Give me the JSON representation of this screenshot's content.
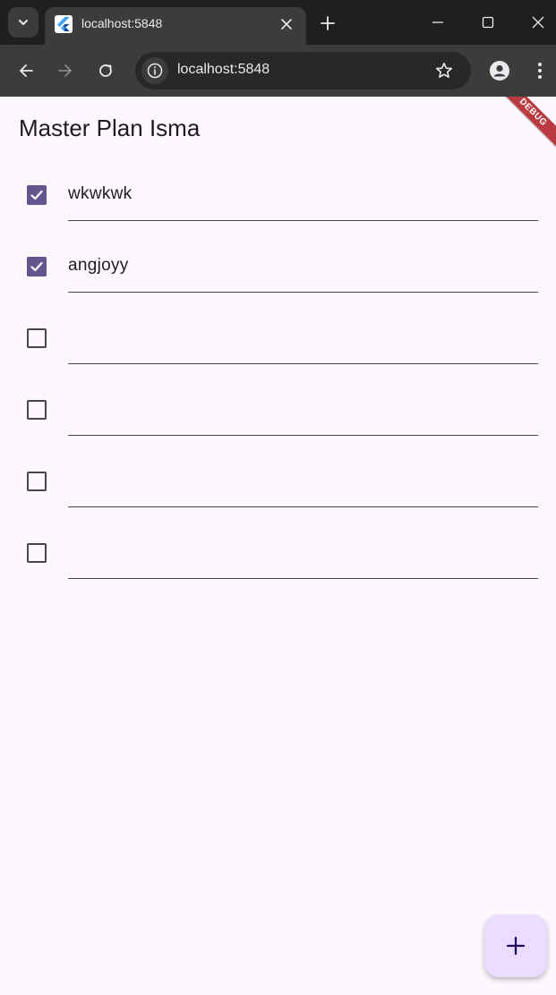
{
  "browser": {
    "tab": {
      "title": "localhost:5848",
      "favicon": "flutter-icon"
    },
    "address_bar": {
      "url": "localhost:5848"
    },
    "icons": {
      "tab_search": "chevron-down-icon",
      "tab_close": "close-icon",
      "new_tab": "plus-icon",
      "minimize": "minimize-icon",
      "maximize": "maximize-icon",
      "close_window": "close-icon",
      "back": "arrow-left-icon",
      "forward": "arrow-right-icon",
      "reload": "reload-icon",
      "site_info": "info-icon",
      "bookmark": "star-icon",
      "profile": "profile-icon",
      "menu": "more-vert-icon"
    }
  },
  "app": {
    "title": "Master Plan Isma",
    "debug_banner": "DEBUG",
    "tasks": [
      {
        "text": "wkwkwk",
        "done": true
      },
      {
        "text": "angjoyy",
        "done": true
      },
      {
        "text": "",
        "done": false
      },
      {
        "text": "",
        "done": false
      },
      {
        "text": "",
        "done": false
      },
      {
        "text": "",
        "done": false
      }
    ],
    "fab_icon": "add-icon",
    "colors": {
      "background": "#fdf7fe",
      "checkbox_checked": "#65558f",
      "fab_background": "#eaddff",
      "debug_banner": "#b93a3f"
    }
  }
}
